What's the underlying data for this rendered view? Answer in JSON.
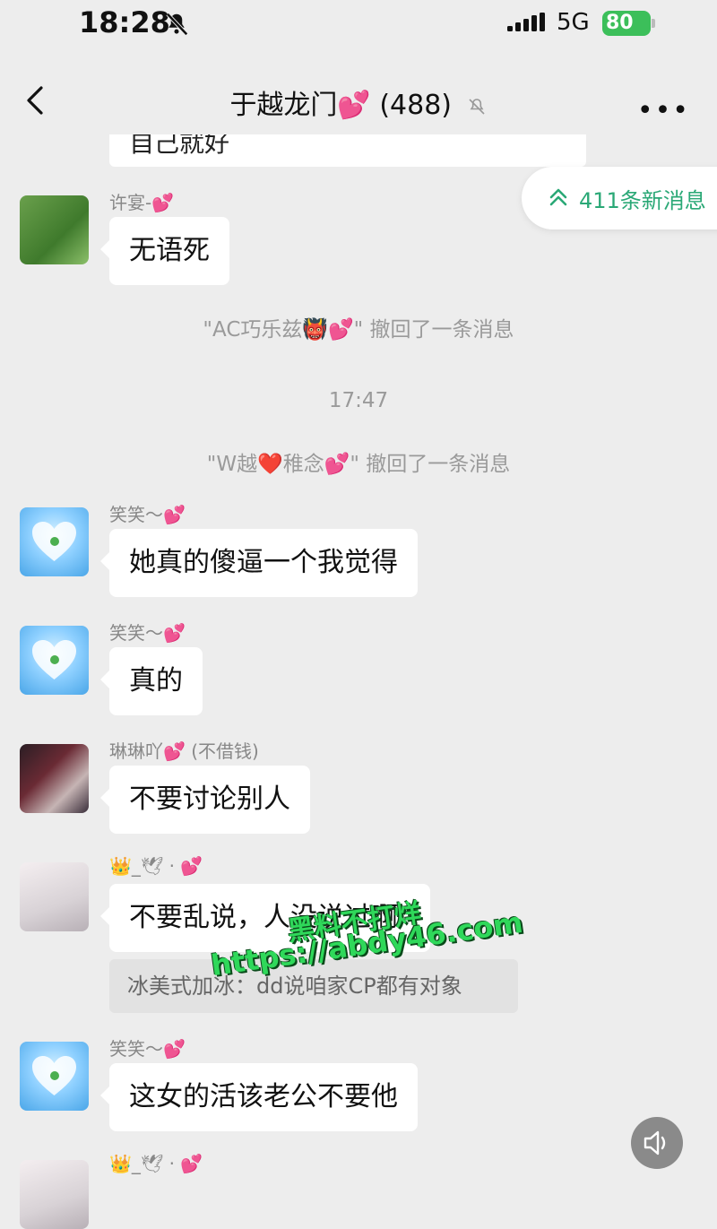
{
  "status_bar": {
    "time": "18:28",
    "network": "5G",
    "battery": "80"
  },
  "header": {
    "title": "于越龙门💕 (488)",
    "more": "•••"
  },
  "top_bubble_partial": "自己就好",
  "new_messages_pill": "411条新消息",
  "messages": [
    {
      "name": "许宴-💕",
      "text": "无语死"
    },
    {
      "name": "笑笑～💕",
      "text": "她真的傻逼一个我觉得"
    },
    {
      "name": "笑笑～💕",
      "text": "真的"
    },
    {
      "name": "琳琳吖💕 (不借钱)",
      "text": "不要讨论别人"
    },
    {
      "name": "👑_🕊 · 💕",
      "text": "不要乱说，人没说过啊"
    },
    {
      "name": "笑笑～💕",
      "text": "这女的活该老公不要他"
    },
    {
      "name": "👑_🕊 · 💕"
    }
  ],
  "system": {
    "recall1": "\"AC巧乐兹👹💕\" 撤回了一条消息",
    "time": "17:47",
    "recall2": "\"W越❤️稚念💕\" 撤回了一条消息"
  },
  "quote_reply": "冰美式加冰：dd说咱家CP都有对象",
  "watermark": {
    "line1": "黑料不打烊",
    "line2": "https://abdy46.com"
  },
  "colors": {
    "accent_green": "#2aa876",
    "background": "#ededed",
    "bubble": "#ffffff"
  }
}
